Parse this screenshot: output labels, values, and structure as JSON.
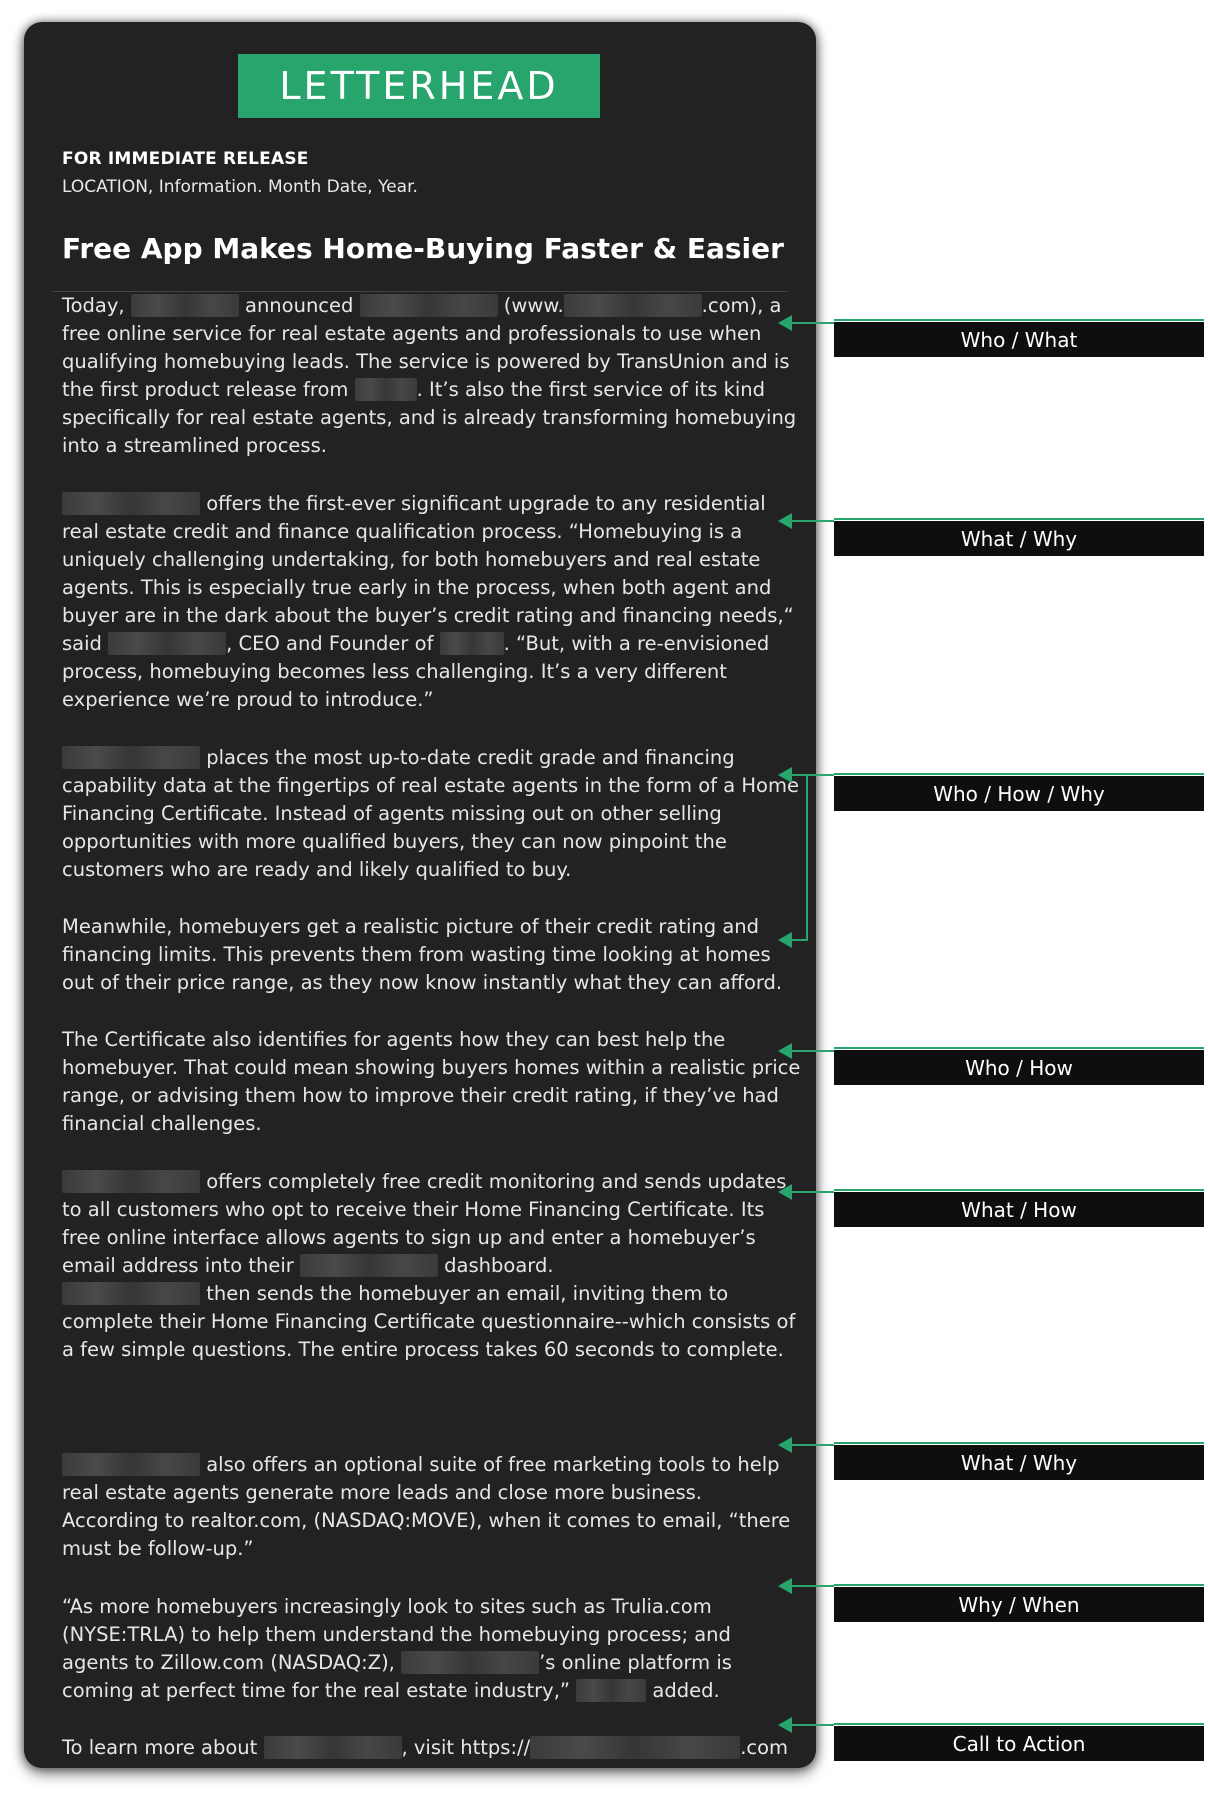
{
  "letterhead": "LETTERHEAD",
  "release_label": "FOR IMMEDIATE RELEASE",
  "dateline": "LOCATION, Information. Month Date, Year.",
  "headline": "Free App Makes Home-Buying Faster & Easier",
  "paragraphs": {
    "p1": {
      "a": "Today, ",
      "b": " announced ",
      "c": " (www.",
      "d": ".com), a free online service for real estate agents and professionals to use when qualifying homebuying leads. The service is powered by TransUnion and is the first product release from ",
      "e": ". It’s also the first service of its kind specifically for real estate agents, and is already transforming homebuying into a streamlined process."
    },
    "p2": {
      "a": " offers the first-ever significant upgrade to any residential real estate credit and finance qualification process. “Homebuying is a uniquely challenging undertaking, for both homebuyers and real estate agents. This is especially true early in the process, when both agent and buyer are in the dark about the buyer’s credit rating and financing needs,“ said ",
      "b": ", CEO and Founder of ",
      "c": ". “But, with a re-envisioned process, homebuying becomes less challenging. It’s a very different experience we’re proud to introduce.”"
    },
    "p3": {
      "a": " places the most up-to-date credit grade and financing capability data at the fingertips of real estate agents in the form of a Home Financing Certificate. Instead of agents missing out on other selling opportunities with more qualified buyers, they can now pinpoint the customers who are ready and likely qualified to buy."
    },
    "p4": {
      "a": "Meanwhile, homebuyers get a realistic picture of their credit rating and financing limits. This prevents them from wasting time looking at homes out of their price range, as they now know instantly what they can afford."
    },
    "p5": {
      "a": "The Certificate also identifies for agents how they can best help the homebuyer. That could mean showing buyers homes within a realistic price range, or advising them how to improve their credit rating, if they’ve had financial challenges."
    },
    "p6": {
      "a": " offers completely free credit monitoring and sends updates to all customers who opt to receive their Home Financing Certificate. Its free online interface allows agents to sign up and enter a homebuyer’s email address into their ",
      "b": " dashboard.",
      "c": " then sends the homebuyer an email, inviting them to complete their Home Financing Certificate questionnaire--which consists of a few simple questions. The entire process takes 60 seconds to complete."
    },
    "p7": {
      "a": " also offers an optional suite of free marketing tools to help real estate agents generate more leads and close more business. According to realtor.com, (NASDAQ:MOVE), when it comes to email, “there must be follow-up.”"
    },
    "p8": {
      "a": "“As more homebuyers increasingly look to sites such as Trulia.com (NYSE:TRLA) to help them understand the homebuying process; and agents to Zillow.com (NASDAQ:Z), ",
      "b": "’s online platform is coming at perfect time for the real estate industry,” ",
      "c": " added."
    },
    "p9": {
      "a": "To learn more about ",
      "b": ", visit https://",
      "c": ".com"
    }
  },
  "annotations": [
    "Who / What",
    "What / Why",
    "Who / How / Why",
    "Who / How",
    "What / How",
    "What / Why",
    "Why / When",
    "Call to Action"
  ],
  "colors": {
    "accent": "#28a56d",
    "document_bg": "#222222",
    "label_bg": "#0e0e0e"
  }
}
